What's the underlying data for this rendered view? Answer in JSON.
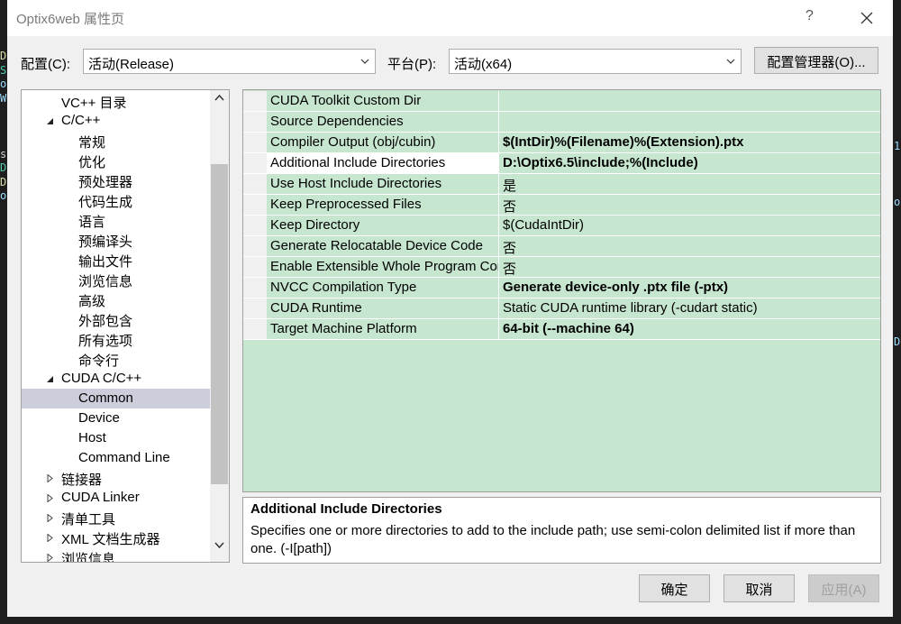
{
  "window": {
    "title": "Optix6web 属性页",
    "help": "?"
  },
  "config": {
    "label": "配置(C):",
    "value": "活动(Release)",
    "platform_label": "平台(P):",
    "platform_value": "活动(x64)",
    "manager_button": "配置管理器(O)..."
  },
  "tree": {
    "items": [
      {
        "label": "VC++ 目录",
        "level": 1,
        "expander": "none"
      },
      {
        "label": "C/C++",
        "level": 1,
        "expander": "expanded"
      },
      {
        "label": "常规",
        "level": 2,
        "expander": "none"
      },
      {
        "label": "优化",
        "level": 2,
        "expander": "none"
      },
      {
        "label": "预处理器",
        "level": 2,
        "expander": "none"
      },
      {
        "label": "代码生成",
        "level": 2,
        "expander": "none"
      },
      {
        "label": "语言",
        "level": 2,
        "expander": "none"
      },
      {
        "label": "预编译头",
        "level": 2,
        "expander": "none"
      },
      {
        "label": "输出文件",
        "level": 2,
        "expander": "none"
      },
      {
        "label": "浏览信息",
        "level": 2,
        "expander": "none"
      },
      {
        "label": "高级",
        "level": 2,
        "expander": "none"
      },
      {
        "label": "外部包含",
        "level": 2,
        "expander": "none"
      },
      {
        "label": "所有选项",
        "level": 2,
        "expander": "none"
      },
      {
        "label": "命令行",
        "level": 2,
        "expander": "none"
      },
      {
        "label": "CUDA C/C++",
        "level": 1,
        "expander": "expanded"
      },
      {
        "label": "Common",
        "level": 2,
        "expander": "none",
        "selected": true
      },
      {
        "label": "Device",
        "level": 2,
        "expander": "none"
      },
      {
        "label": "Host",
        "level": 2,
        "expander": "none"
      },
      {
        "label": "Command Line",
        "level": 2,
        "expander": "none"
      },
      {
        "label": "链接器",
        "level": 1,
        "expander": "collapsed"
      },
      {
        "label": "CUDA Linker",
        "level": 1,
        "expander": "collapsed"
      },
      {
        "label": "清单工具",
        "level": 1,
        "expander": "collapsed"
      },
      {
        "label": "XML 文档生成器",
        "level": 1,
        "expander": "collapsed"
      },
      {
        "label": "浏览信息",
        "level": 1,
        "expander": "collapsed"
      }
    ]
  },
  "properties": [
    {
      "name": "CUDA Toolkit Custom Dir",
      "value": "",
      "bold": false
    },
    {
      "name": "Source Dependencies",
      "value": "",
      "bold": false
    },
    {
      "name": "Compiler Output (obj/cubin)",
      "value": "$(IntDir)%(Filename)%(Extension).ptx",
      "bold": true
    },
    {
      "name": "Additional Include Directories",
      "value": "D:\\Optix6.5\\include;%(Include)",
      "bold": true,
      "selected": true
    },
    {
      "name": "Use Host Include Directories",
      "value": "是",
      "bold": false
    },
    {
      "name": "Keep Preprocessed Files",
      "value": "否",
      "bold": false
    },
    {
      "name": "Keep Directory",
      "value": "$(CudaIntDir)",
      "bold": false
    },
    {
      "name": "Generate Relocatable Device Code",
      "value": "否",
      "bold": false
    },
    {
      "name": "Enable Extensible Whole Program Compilation",
      "value": "否",
      "bold": false
    },
    {
      "name": "NVCC Compilation Type",
      "value": "Generate device-only .ptx file (-ptx)",
      "bold": true
    },
    {
      "name": "CUDA Runtime",
      "value": "Static CUDA runtime library (-cudart static)",
      "bold": false
    },
    {
      "name": "Target Machine Platform",
      "value": "64-bit (--machine 64)",
      "bold": true
    }
  ],
  "description": {
    "title": "Additional Include Directories",
    "text": "Specifies one or more directories to add to the include path; use semi-colon delimited list if more than one. (-I[path])"
  },
  "buttons": {
    "ok": "确定",
    "cancel": "取消",
    "apply": "应用(A)"
  },
  "background_code": {
    "left": [
      "D",
      "S",
      "o",
      "W",
      "",
      "",
      "",
      "s",
      "D",
      "D",
      "o"
    ],
    "right": [
      "1",
      "",
      "",
      "",
      "o",
      "",
      "",
      "",
      "",
      "",
      "",
      "",
      "",
      "",
      "D"
    ]
  },
  "colors": {
    "grid_bg": "#c6e6cf",
    "selected_tree": "#cccedb",
    "left_code_colors": [
      "#dcdcaa",
      "#4ec9b0",
      "#9cdcfe",
      "#9cdcfe",
      "",
      "",
      "",
      "#d4d4d4",
      "#4ec9b0",
      "#dcdcaa",
      "#9cdcfe"
    ]
  }
}
